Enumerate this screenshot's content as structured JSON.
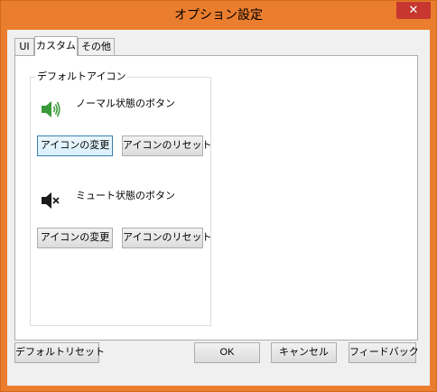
{
  "window": {
    "title": "オプション設定",
    "close_glyph": "✕"
  },
  "tabs": [
    {
      "label": "UI",
      "active": false
    },
    {
      "label": "カスタム",
      "active": true
    },
    {
      "label": "その他",
      "active": false
    }
  ],
  "custom_tab": {
    "group_label": "デフォルトアイコン",
    "normal": {
      "icon": "speaker-volume-icon",
      "label": "ノーマル状態のボタン",
      "change_button": "アイコンの変更",
      "reset_button": "アイコンのリセット"
    },
    "mute": {
      "icon": "speaker-mute-icon",
      "label": "ミュート状態のボタン",
      "change_button": "アイコンの変更",
      "reset_button": "アイコンのリセット"
    }
  },
  "footer": {
    "default_reset": "デフォルトリセット",
    "ok": "OK",
    "cancel": "キャンセル",
    "feedback": "フィードバック"
  },
  "colors": {
    "title_bar": "#eb7d2e",
    "close_button": "#c7372f",
    "focus_border": "#3c7fb1",
    "volume_icon": "#3a9a3a"
  }
}
